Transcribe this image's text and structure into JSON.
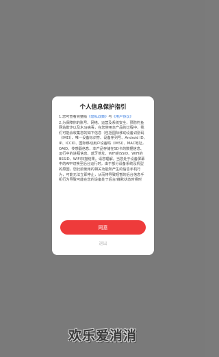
{
  "dialog": {
    "title": "个人信息保护指引",
    "p1_prefix": "1.您可查看完整版",
    "privacy_link": "《隐私政策》",
    "p1_mid": "与",
    "user_agreement_link": "《用户协议》",
    "p2": "2.为保障你的账号、网络、运营及系统安全，预防钓鱼网站欺诈以及木马病毒，在您使用本产品的过程中，我们可能会收集您的如下信息（包括国际移动设备识别码（IMEI）、唯一设备标识符、设备序列号、Android ID、IP、ICCID、国际移动用户设备码（IMSI）、MAC地址，OAID、传感器信息、本产品存储在SD卡的数据信息、运行中的进程信息、蓝牙地址、WIFI的SSID、WIFI的BSSID、WIFI扫描结果。请您理解，当您处于设备屏幕中的APP切换至后台运行时，由于部分设备系统及机型的原因，您此前使用的相关功能所产生的信息手机行为，可能无法立即停止，从而将导致短暂的后台信息手机行为导致可能在您的设备处于后台/静默状态时候时",
    "agree_label": "同意",
    "exit_label": "退出"
  },
  "logo_text": "欢乐爱消消"
}
